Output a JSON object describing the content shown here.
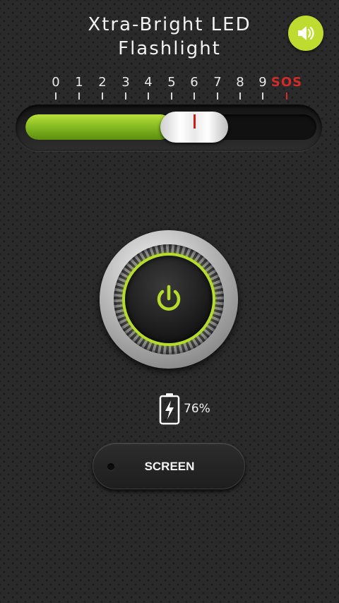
{
  "header": {
    "title_line1": "Xtra-Bright LED",
    "title_line2": "Flashlight",
    "sound_icon": "speaker-volume-icon"
  },
  "strobe": {
    "labels": [
      "0",
      "1",
      "2",
      "3",
      "4",
      "5",
      "6",
      "7",
      "8",
      "9",
      "SOS"
    ],
    "selected_level": 6,
    "level_color_sos": "#d42a2a"
  },
  "power": {
    "icon": "power-icon",
    "accent": "#b6dc2b"
  },
  "battery": {
    "icon": "battery-charging-icon",
    "percent_text": "76%",
    "level": 0.76
  },
  "screen_button": {
    "label": "SCREEN"
  },
  "colors": {
    "accent_green": "#bddc2f",
    "sos_red": "#d42a2a",
    "background": "#2a2a2a"
  }
}
